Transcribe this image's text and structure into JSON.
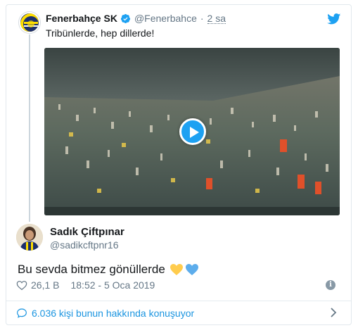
{
  "parent_tweet": {
    "name": "Fenerbahçe SK",
    "handle": "@Fenerbahce",
    "separator": "·",
    "time": "2 sa",
    "text": "Tribünlerde, hep dillerde!"
  },
  "tweet": {
    "name": "Sadık Çiftpınar",
    "handle": "@sadikcftpnr16",
    "text": "Bu sevda bitmez gönüllerde",
    "emojis": [
      "yellow-heart",
      "blue-heart"
    ],
    "likes": "26,1 B",
    "timestamp": "18:52 - 5 Oca 2019"
  },
  "conversation": {
    "label": "6.036 kişi bunun hakkında konuşuyor"
  },
  "info": {
    "glyph": "i"
  },
  "colors": {
    "accent": "#1da1f2",
    "link": "#1b95e0",
    "secondary_text": "#657786",
    "heart_yellow": "#ffcc4d",
    "heart_blue": "#5dadec"
  }
}
